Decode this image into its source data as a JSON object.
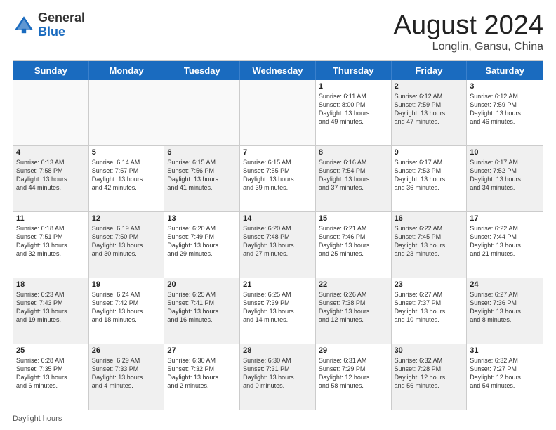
{
  "header": {
    "logo_general": "General",
    "logo_blue": "Blue",
    "month_title": "August 2024",
    "location": "Longlin, Gansu, China"
  },
  "weekdays": [
    "Sunday",
    "Monday",
    "Tuesday",
    "Wednesday",
    "Thursday",
    "Friday",
    "Saturday"
  ],
  "footer": {
    "label": "Daylight hours"
  },
  "rows": [
    [
      {
        "day": "",
        "info": "",
        "shaded": false,
        "empty": true
      },
      {
        "day": "",
        "info": "",
        "shaded": false,
        "empty": true
      },
      {
        "day": "",
        "info": "",
        "shaded": false,
        "empty": true
      },
      {
        "day": "",
        "info": "",
        "shaded": false,
        "empty": true
      },
      {
        "day": "1",
        "info": "Sunrise: 6:11 AM\nSunset: 8:00 PM\nDaylight: 13 hours\nand 49 minutes.",
        "shaded": false,
        "empty": false
      },
      {
        "day": "2",
        "info": "Sunrise: 6:12 AM\nSunset: 7:59 PM\nDaylight: 13 hours\nand 47 minutes.",
        "shaded": true,
        "empty": false
      },
      {
        "day": "3",
        "info": "Sunrise: 6:12 AM\nSunset: 7:59 PM\nDaylight: 13 hours\nand 46 minutes.",
        "shaded": false,
        "empty": false
      }
    ],
    [
      {
        "day": "4",
        "info": "Sunrise: 6:13 AM\nSunset: 7:58 PM\nDaylight: 13 hours\nand 44 minutes.",
        "shaded": true,
        "empty": false
      },
      {
        "day": "5",
        "info": "Sunrise: 6:14 AM\nSunset: 7:57 PM\nDaylight: 13 hours\nand 42 minutes.",
        "shaded": false,
        "empty": false
      },
      {
        "day": "6",
        "info": "Sunrise: 6:15 AM\nSunset: 7:56 PM\nDaylight: 13 hours\nand 41 minutes.",
        "shaded": true,
        "empty": false
      },
      {
        "day": "7",
        "info": "Sunrise: 6:15 AM\nSunset: 7:55 PM\nDaylight: 13 hours\nand 39 minutes.",
        "shaded": false,
        "empty": false
      },
      {
        "day": "8",
        "info": "Sunrise: 6:16 AM\nSunset: 7:54 PM\nDaylight: 13 hours\nand 37 minutes.",
        "shaded": true,
        "empty": false
      },
      {
        "day": "9",
        "info": "Sunrise: 6:17 AM\nSunset: 7:53 PM\nDaylight: 13 hours\nand 36 minutes.",
        "shaded": false,
        "empty": false
      },
      {
        "day": "10",
        "info": "Sunrise: 6:17 AM\nSunset: 7:52 PM\nDaylight: 13 hours\nand 34 minutes.",
        "shaded": true,
        "empty": false
      }
    ],
    [
      {
        "day": "11",
        "info": "Sunrise: 6:18 AM\nSunset: 7:51 PM\nDaylight: 13 hours\nand 32 minutes.",
        "shaded": false,
        "empty": false
      },
      {
        "day": "12",
        "info": "Sunrise: 6:19 AM\nSunset: 7:50 PM\nDaylight: 13 hours\nand 30 minutes.",
        "shaded": true,
        "empty": false
      },
      {
        "day": "13",
        "info": "Sunrise: 6:20 AM\nSunset: 7:49 PM\nDaylight: 13 hours\nand 29 minutes.",
        "shaded": false,
        "empty": false
      },
      {
        "day": "14",
        "info": "Sunrise: 6:20 AM\nSunset: 7:48 PM\nDaylight: 13 hours\nand 27 minutes.",
        "shaded": true,
        "empty": false
      },
      {
        "day": "15",
        "info": "Sunrise: 6:21 AM\nSunset: 7:46 PM\nDaylight: 13 hours\nand 25 minutes.",
        "shaded": false,
        "empty": false
      },
      {
        "day": "16",
        "info": "Sunrise: 6:22 AM\nSunset: 7:45 PM\nDaylight: 13 hours\nand 23 minutes.",
        "shaded": true,
        "empty": false
      },
      {
        "day": "17",
        "info": "Sunrise: 6:22 AM\nSunset: 7:44 PM\nDaylight: 13 hours\nand 21 minutes.",
        "shaded": false,
        "empty": false
      }
    ],
    [
      {
        "day": "18",
        "info": "Sunrise: 6:23 AM\nSunset: 7:43 PM\nDaylight: 13 hours\nand 19 minutes.",
        "shaded": true,
        "empty": false
      },
      {
        "day": "19",
        "info": "Sunrise: 6:24 AM\nSunset: 7:42 PM\nDaylight: 13 hours\nand 18 minutes.",
        "shaded": false,
        "empty": false
      },
      {
        "day": "20",
        "info": "Sunrise: 6:25 AM\nSunset: 7:41 PM\nDaylight: 13 hours\nand 16 minutes.",
        "shaded": true,
        "empty": false
      },
      {
        "day": "21",
        "info": "Sunrise: 6:25 AM\nSunset: 7:39 PM\nDaylight: 13 hours\nand 14 minutes.",
        "shaded": false,
        "empty": false
      },
      {
        "day": "22",
        "info": "Sunrise: 6:26 AM\nSunset: 7:38 PM\nDaylight: 13 hours\nand 12 minutes.",
        "shaded": true,
        "empty": false
      },
      {
        "day": "23",
        "info": "Sunrise: 6:27 AM\nSunset: 7:37 PM\nDaylight: 13 hours\nand 10 minutes.",
        "shaded": false,
        "empty": false
      },
      {
        "day": "24",
        "info": "Sunrise: 6:27 AM\nSunset: 7:36 PM\nDaylight: 13 hours\nand 8 minutes.",
        "shaded": true,
        "empty": false
      }
    ],
    [
      {
        "day": "25",
        "info": "Sunrise: 6:28 AM\nSunset: 7:35 PM\nDaylight: 13 hours\nand 6 minutes.",
        "shaded": false,
        "empty": false
      },
      {
        "day": "26",
        "info": "Sunrise: 6:29 AM\nSunset: 7:33 PM\nDaylight: 13 hours\nand 4 minutes.",
        "shaded": true,
        "empty": false
      },
      {
        "day": "27",
        "info": "Sunrise: 6:30 AM\nSunset: 7:32 PM\nDaylight: 13 hours\nand 2 minutes.",
        "shaded": false,
        "empty": false
      },
      {
        "day": "28",
        "info": "Sunrise: 6:30 AM\nSunset: 7:31 PM\nDaylight: 13 hours\nand 0 minutes.",
        "shaded": true,
        "empty": false
      },
      {
        "day": "29",
        "info": "Sunrise: 6:31 AM\nSunset: 7:29 PM\nDaylight: 12 hours\nand 58 minutes.",
        "shaded": false,
        "empty": false
      },
      {
        "day": "30",
        "info": "Sunrise: 6:32 AM\nSunset: 7:28 PM\nDaylight: 12 hours\nand 56 minutes.",
        "shaded": true,
        "empty": false
      },
      {
        "day": "31",
        "info": "Sunrise: 6:32 AM\nSunset: 7:27 PM\nDaylight: 12 hours\nand 54 minutes.",
        "shaded": false,
        "empty": false
      }
    ]
  ]
}
